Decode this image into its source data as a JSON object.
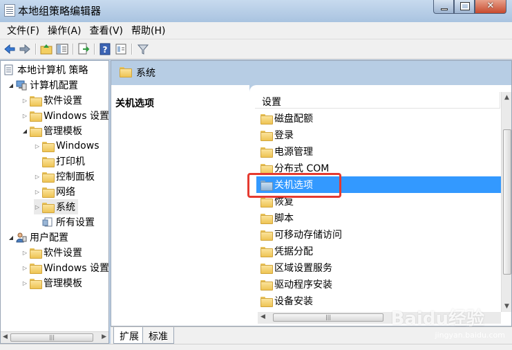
{
  "window": {
    "title": "本地组策略编辑器"
  },
  "menu": [
    {
      "label": "文件(F)"
    },
    {
      "label": "操作(A)"
    },
    {
      "label": "查看(V)"
    },
    {
      "label": "帮助(H)"
    }
  ],
  "toolbar": {
    "icons": [
      "back-arrow-icon",
      "forward-arrow-icon",
      "up-folder-icon",
      "show-hide-tree-icon",
      "export-list-icon",
      "help-icon",
      "properties-icon",
      "filter-icon"
    ]
  },
  "tree": [
    {
      "label": "本地计算机 策略",
      "level": 0,
      "state": "none",
      "icon": "policy-icon"
    },
    {
      "label": "计算机配置",
      "level": 1,
      "state": "open",
      "icon": "computer-icon"
    },
    {
      "label": "软件设置",
      "level": 2,
      "state": "closed",
      "icon": "folder-icon"
    },
    {
      "label": "Windows 设置",
      "level": 2,
      "state": "closed",
      "icon": "folder-icon"
    },
    {
      "label": "管理模板",
      "level": 2,
      "state": "open",
      "icon": "folder-icon"
    },
    {
      "label": "Windows",
      "level": 3,
      "state": "closed",
      "icon": "folder-icon"
    },
    {
      "label": "打印机",
      "level": 3,
      "state": "none",
      "icon": "folder-icon"
    },
    {
      "label": "控制面板",
      "level": 3,
      "state": "closed",
      "icon": "folder-icon"
    },
    {
      "label": "网络",
      "level": 3,
      "state": "closed",
      "icon": "folder-icon"
    },
    {
      "label": "系统",
      "level": 3,
      "state": "closed",
      "icon": "folder-icon"
    },
    {
      "label": "所有设置",
      "level": 3,
      "state": "none",
      "icon": "settings-page-icon"
    },
    {
      "label": "用户配置",
      "level": 1,
      "state": "open",
      "icon": "user-icon"
    },
    {
      "label": "软件设置",
      "level": 2,
      "state": "closed",
      "icon": "folder-icon"
    },
    {
      "label": "Windows 设置",
      "level": 2,
      "state": "closed",
      "icon": "folder-icon"
    },
    {
      "label": "管理模板",
      "level": 2,
      "state": "closed",
      "icon": "folder-icon"
    }
  ],
  "header": {
    "title": "系统"
  },
  "description": {
    "title": "关机选项"
  },
  "list": {
    "column": "设置",
    "items": [
      {
        "label": "磁盘配额",
        "selected": false
      },
      {
        "label": "登录",
        "selected": false
      },
      {
        "label": "电源管理",
        "selected": false
      },
      {
        "label": "分布式 COM",
        "selected": false
      },
      {
        "label": "关机选项",
        "selected": true
      },
      {
        "label": "恢复",
        "selected": false
      },
      {
        "label": "脚本",
        "selected": false
      },
      {
        "label": "可移动存储访问",
        "selected": false
      },
      {
        "label": "凭据分配",
        "selected": false
      },
      {
        "label": "区域设置服务",
        "selected": false
      },
      {
        "label": "驱动程序安装",
        "selected": false
      },
      {
        "label": "设备安装",
        "selected": false
      }
    ]
  },
  "tabs": [
    {
      "label": "扩展",
      "active": true
    },
    {
      "label": "标准",
      "active": false
    }
  ],
  "watermark": {
    "brand": "Baidu经验",
    "url": "jingyan.baidu.com"
  },
  "colors": {
    "selection": "#3399ff",
    "highlight": "#e53a30",
    "header": "#b7cde4"
  }
}
